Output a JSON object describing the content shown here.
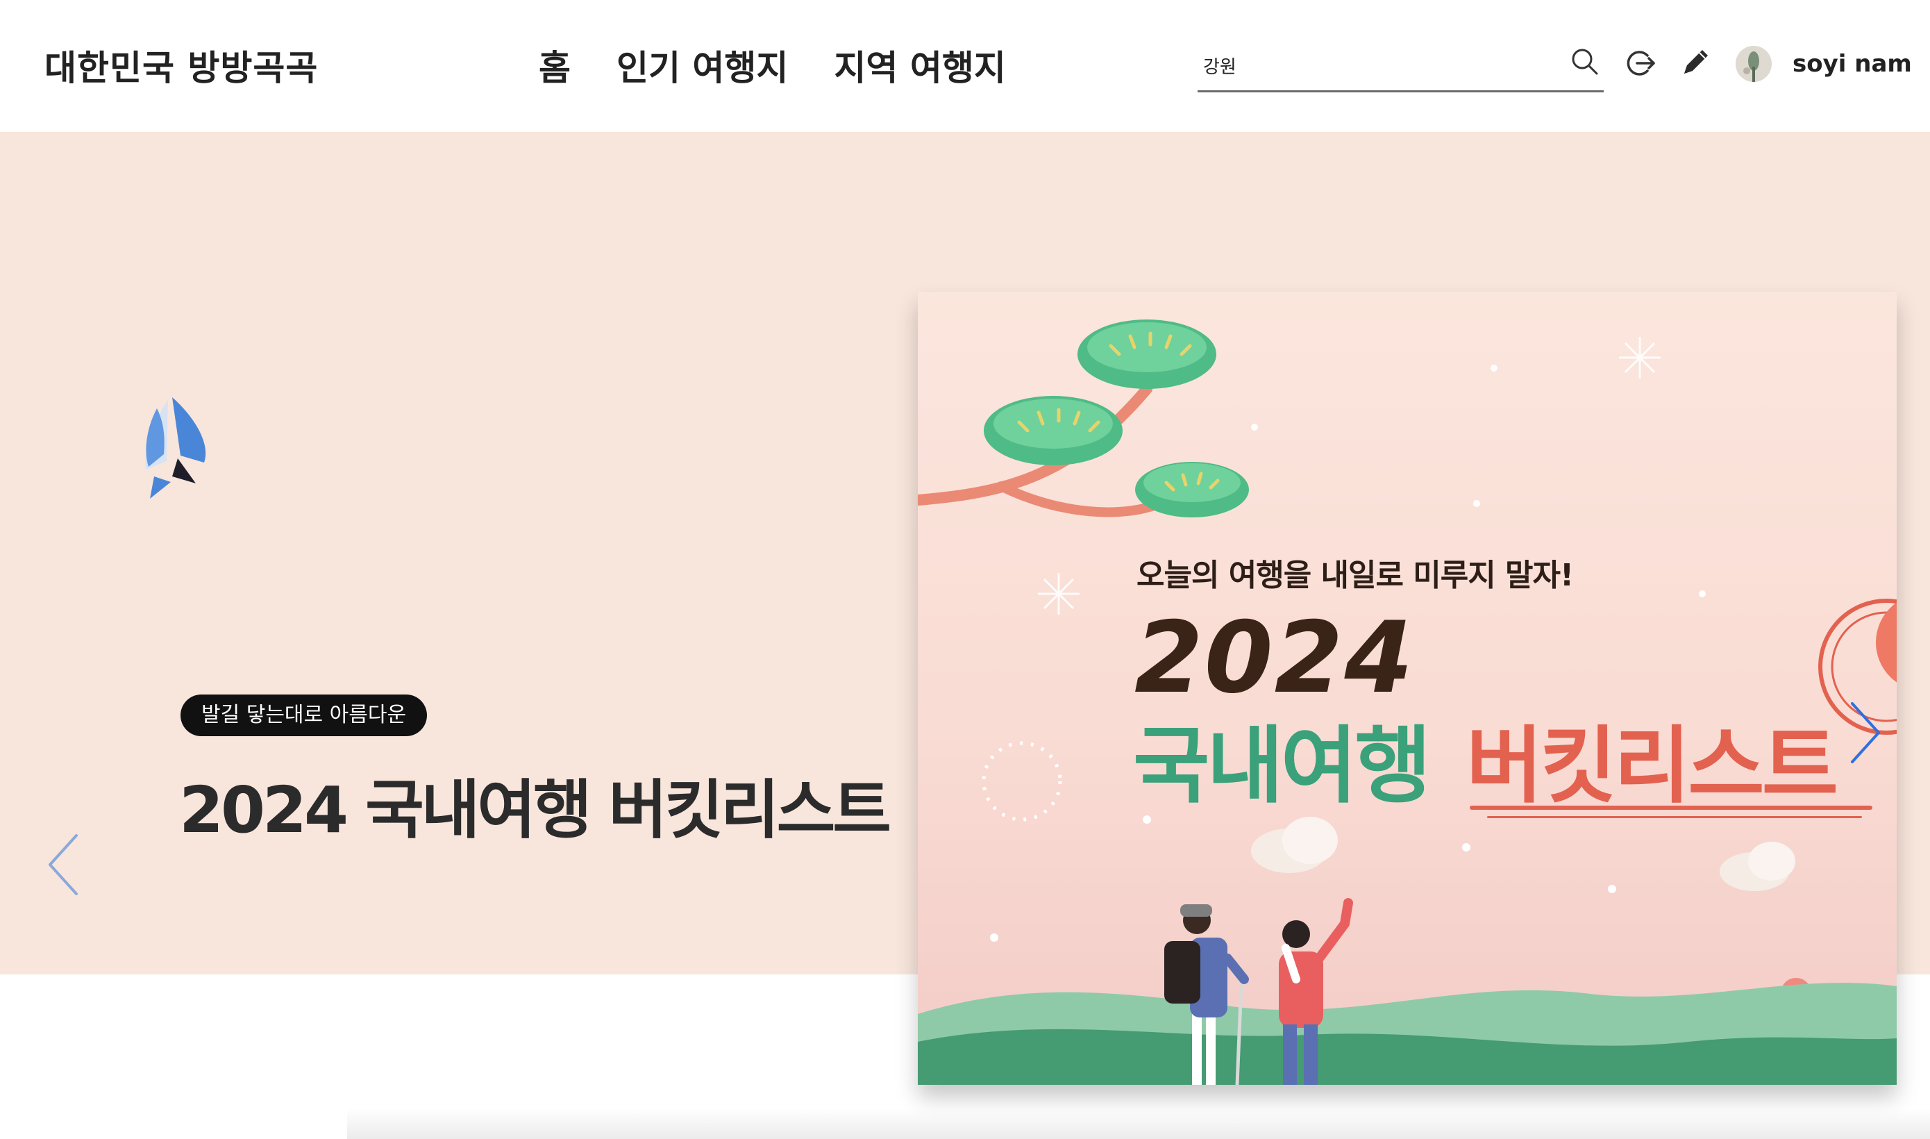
{
  "header": {
    "logo": "대한민국 방방곡곡",
    "nav": [
      {
        "label": "홈"
      },
      {
        "label": "인기 여행지"
      },
      {
        "label": "지역 여행지"
      }
    ],
    "search": {
      "value": "강원"
    },
    "user": {
      "name": "soyi nam"
    }
  },
  "hero": {
    "tag": "발길 닿는대로 아름다운",
    "title": "2024 국내여행 버킷리스트",
    "poster": {
      "subtitle": "오늘의 여행을 내일로 미루지 말자!",
      "year": "2024",
      "line1": "국내여행",
      "line2": "버킷리스트"
    }
  },
  "colors": {
    "hero_bg": "#f8e6dc",
    "accent_green": "#3aa17a",
    "accent_red": "#e3614f",
    "plane_blue": "#4a86d8",
    "arrow_blue": "#2f6fe0"
  },
  "icons": [
    "search-icon",
    "logout-icon",
    "pencil-icon",
    "avatar",
    "airplane-icon",
    "chevron-left-icon",
    "chevron-right-icon"
  ]
}
